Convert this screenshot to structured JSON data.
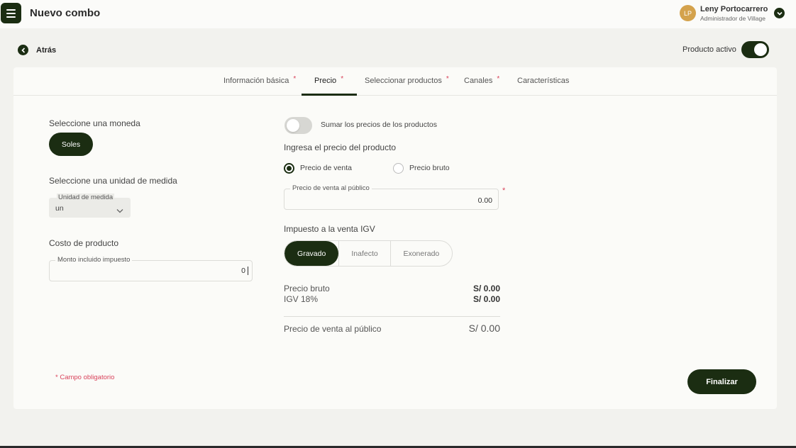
{
  "header": {
    "title": "Nuevo combo",
    "user": {
      "initials": "LP",
      "name": "Leny Portocarrero",
      "role": "Administrador de Village"
    }
  },
  "toolbar": {
    "back_label": "Atrás",
    "product_active_label": "Producto activo",
    "product_active": true
  },
  "tabs": [
    {
      "label": "Información básica",
      "required": true,
      "active": false
    },
    {
      "label": "Precio",
      "required": true,
      "active": true
    },
    {
      "label": "Seleccionar productos",
      "required": true,
      "active": false
    },
    {
      "label": "Canales",
      "required": true,
      "active": false
    },
    {
      "label": "Características",
      "required": false,
      "active": false
    }
  ],
  "left": {
    "currency_label": "Seleccione una moneda",
    "currency_selected": "Soles",
    "unit_label": "Seleccione una unidad de medida",
    "unit_field_label": "Unidad de medida",
    "unit_value": "un",
    "cost_label": "Costo de producto",
    "cost_field_label": "Monto incluido impuesto",
    "cost_value": "0"
  },
  "right": {
    "sum_toggle_label": "Sumar los precios de los productos",
    "sum_toggle_on": false,
    "price_heading": "Ingresa el precio del producto",
    "radio_sale": "Precio de venta",
    "radio_gross": "Precio bruto",
    "selected_radio": "Precio de venta",
    "public_price_label": "Precio de venta al público",
    "public_price_value": "0.00",
    "required_mark": "*",
    "tax_heading": "Impuesto a la venta IGV",
    "tax_options": [
      "Gravado",
      "Inafecto",
      "Exonerado"
    ],
    "tax_selected": "Gravado"
  },
  "summary": {
    "gross_label": "Precio bruto",
    "gross_value": "S/ 0.00",
    "igv_label": "IGV 18%",
    "igv_value": "S/ 0.00",
    "total_label": "Precio de venta al público",
    "total_value": "S/ 0.00"
  },
  "footer": {
    "required_note": "* Campo obligatorio",
    "finish_label": "Finalizar"
  },
  "colors": {
    "primary": "#1b2d12",
    "required": "#d9435b",
    "avatar": "#d4a24c"
  }
}
